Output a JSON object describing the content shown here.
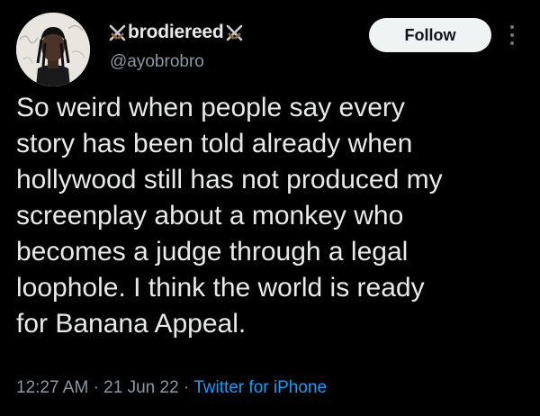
{
  "user": {
    "display_name": "brodiereed",
    "handle": "@ayobrobro",
    "name_emoji": "crossed-swords-icon"
  },
  "follow_button": {
    "label": "Follow"
  },
  "tweet": {
    "lines": [
      "So weird when people say every",
      "story has been told already when",
      "hollywood still has not produced my",
      "screenplay about a monkey who",
      "becomes a judge through a legal",
      "loophole. I think the world is ready",
      "for Banana Appeal."
    ]
  },
  "meta": {
    "time": "12:27 AM",
    "separator": "·",
    "date": "21 Jun 22",
    "source": "Twitter for iPhone"
  },
  "colors": {
    "background": "#000000",
    "text": "#e7e9ea",
    "muted": "#8b98a5",
    "link": "#1d9bf0",
    "button_bg": "#eff3f4"
  }
}
